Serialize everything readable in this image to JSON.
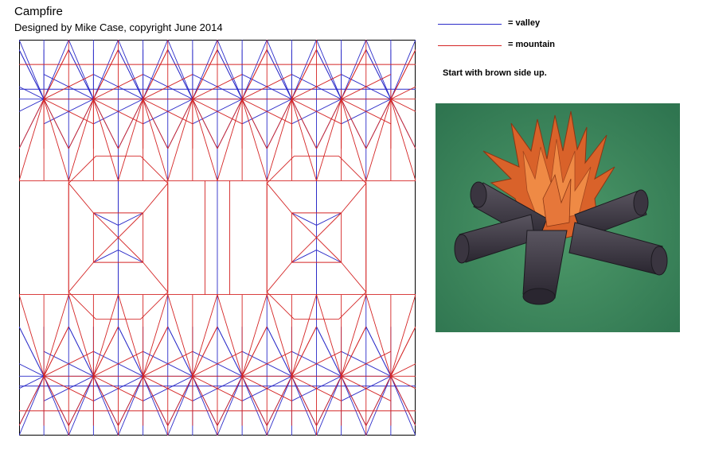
{
  "header": {
    "title": "Campfire",
    "subtitle": "Designed by Mike Case, copyright June 2014"
  },
  "legend": {
    "valley_label": "= valley",
    "mountain_label": "= mountain",
    "valley_color": "#2b2bc8",
    "mountain_color": "#d42424"
  },
  "instruction": "Start with brown side up.",
  "photo": {
    "subject": "origami campfire model"
  }
}
